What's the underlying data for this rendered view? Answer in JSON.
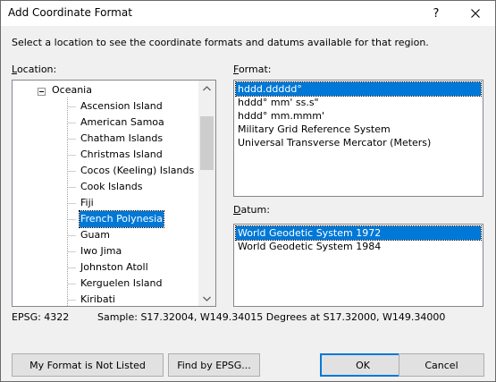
{
  "window": {
    "title": "Add Coordinate Format",
    "help_glyph": "?"
  },
  "instruction": "Select a location to see the coordinate formats and datums available for that region.",
  "location": {
    "label_accel": "L",
    "label_rest": "ocation:",
    "root": "Oceania",
    "children": [
      "Ascension Island",
      "American Samoa",
      "Chatham Islands",
      "Christmas Island",
      "Cocos (Keeling) Islands",
      "Cook Islands",
      "Fiji",
      "French Polynesia",
      "Guam",
      "Iwo Jima",
      "Johnston Atoll",
      "Kerguelen Island",
      "Kiribati"
    ],
    "selected": "French Polynesia"
  },
  "format": {
    "label_accel": "F",
    "label_rest": "ormat:",
    "items": [
      "hddd.ddddd°",
      "hddd° mm' ss.s\"",
      "hddd° mm.mmm'",
      "Military Grid Reference System",
      "Universal Transverse Mercator (Meters)"
    ],
    "selected": "hddd.ddddd°"
  },
  "datum": {
    "label_accel": "D",
    "label_rest": "atum:",
    "items": [
      "World Geodetic System 1972",
      "World Geodetic System 1984"
    ],
    "selected": "World Geodetic System 1972"
  },
  "status": {
    "epsg": "EPSG: 4322",
    "sample": "Sample: S17.32004, W149.34015 Degrees at S17.32000, W149.34000"
  },
  "buttons": {
    "not_listed": "My Format is Not Listed",
    "find_epsg": "Find by EPSG...",
    "ok": "OK",
    "cancel": "Cancel"
  },
  "colors": {
    "selection": "#0078d7",
    "window_bg": "#f0f0f0"
  }
}
